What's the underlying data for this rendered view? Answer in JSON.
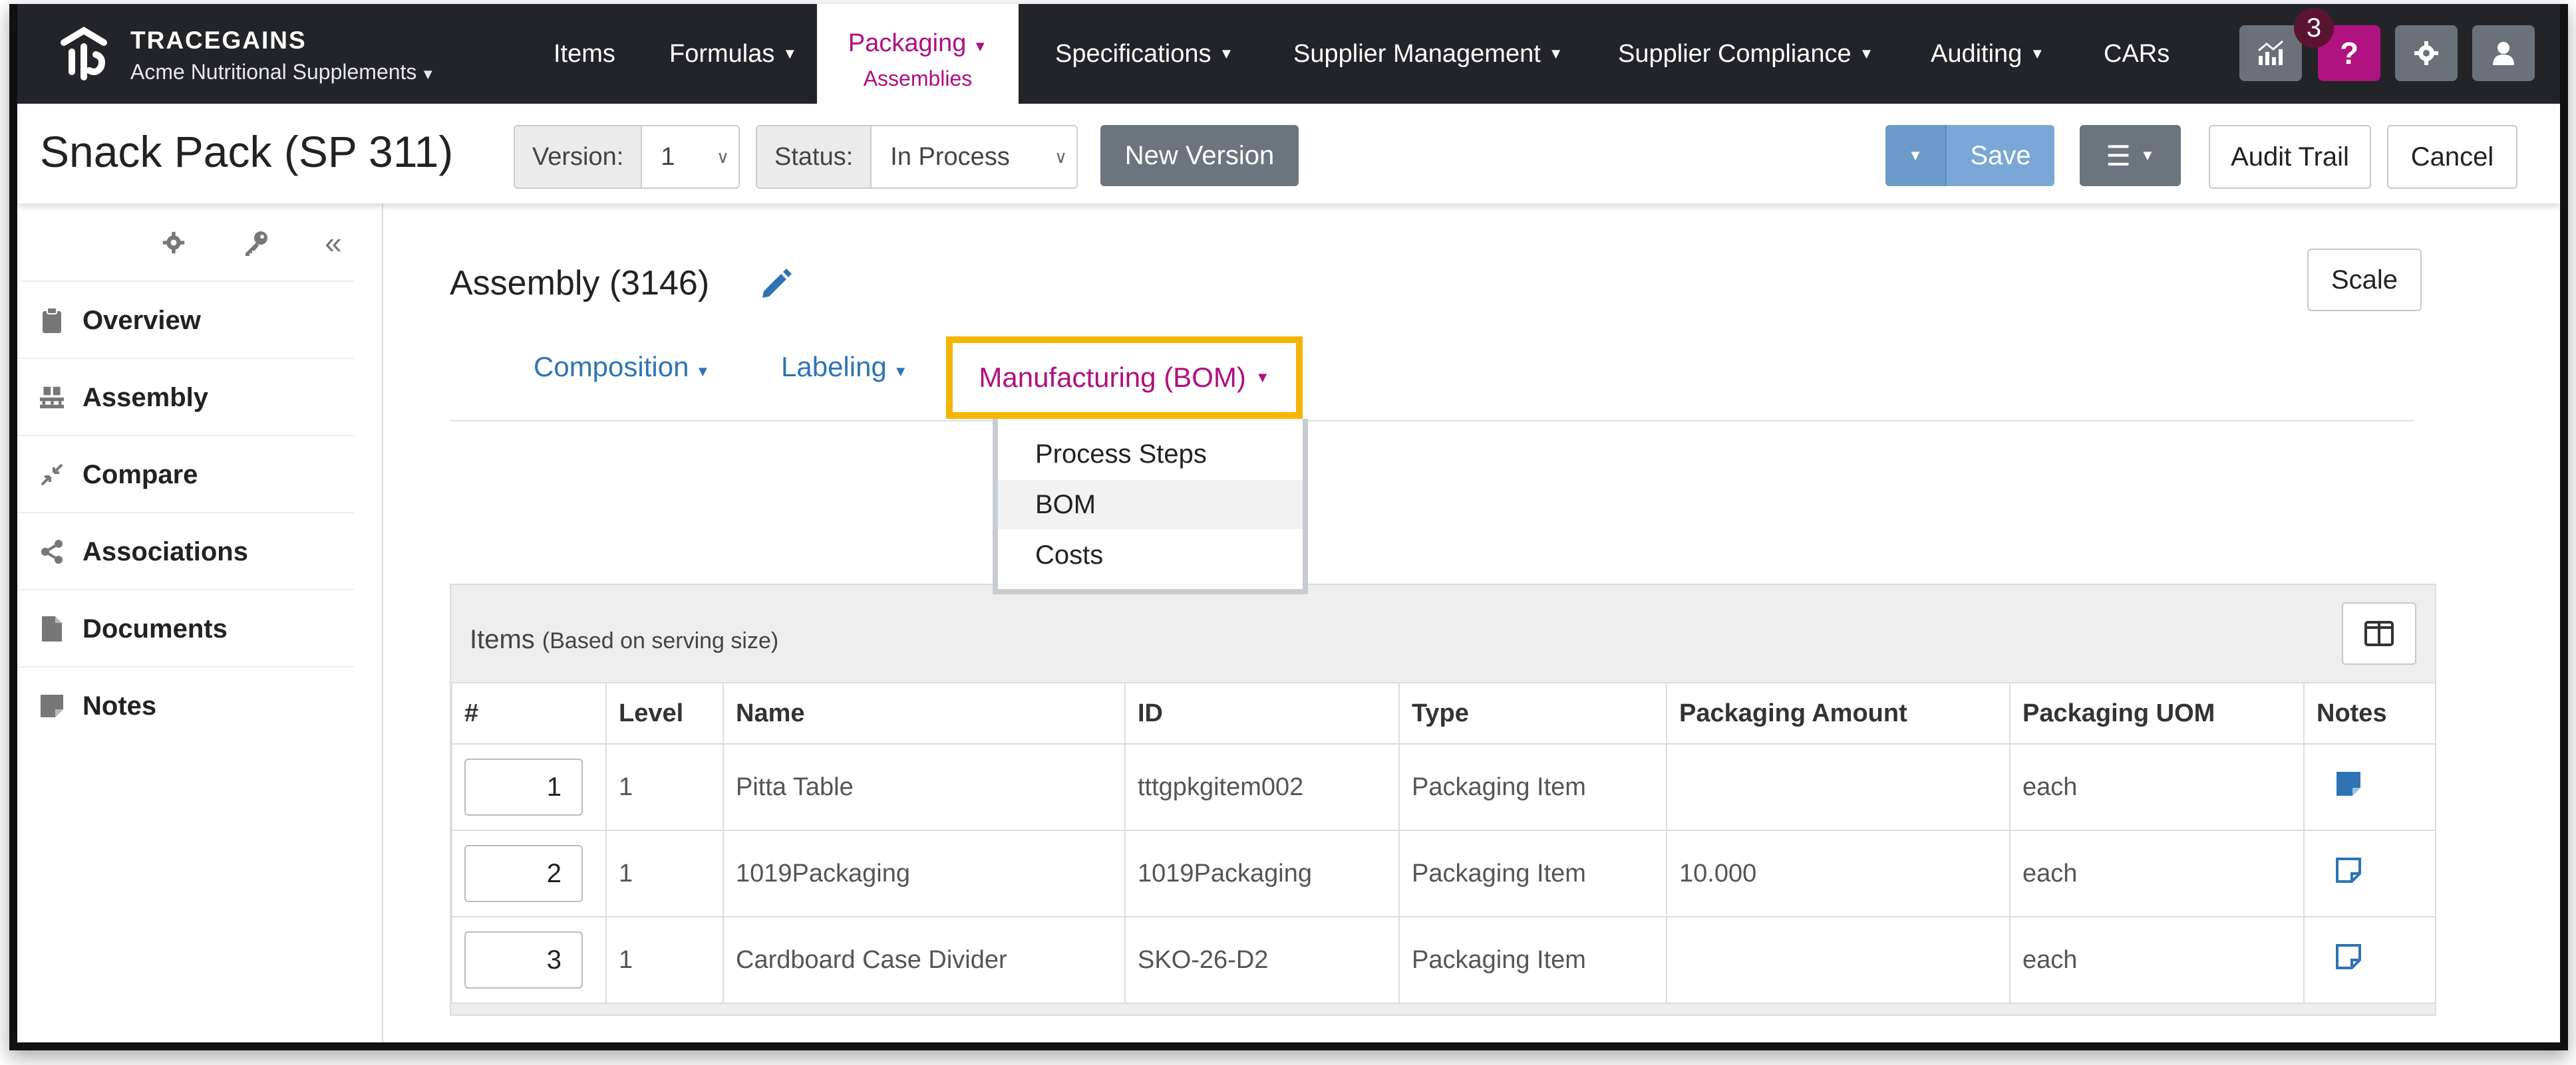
{
  "brand": {
    "name": "TRACEGAINS",
    "company": "Acme Nutritional Supplements"
  },
  "nav": {
    "items": [
      "Items",
      "Formulas",
      "Specifications",
      "Supplier Management",
      "Supplier Compliance",
      "Auditing",
      "CARs"
    ],
    "active": {
      "label": "Packaging",
      "sub": "Assemblies"
    },
    "notification_count": "3",
    "help_label": "?",
    "accent_color": "#b0127f"
  },
  "titlebar": {
    "title": "Snack Pack (SP 311)",
    "version_label": "Version:",
    "version_value": "1",
    "status_label": "Status:",
    "status_value": "In Process",
    "new_version": "New Version",
    "save": "Save",
    "audit_trail": "Audit Trail",
    "cancel": "Cancel"
  },
  "sidebar": {
    "items": [
      {
        "label": "Overview",
        "icon": "clipboard-icon"
      },
      {
        "label": "Assembly",
        "icon": "pallet-icon"
      },
      {
        "label": "Compare",
        "icon": "compress-arrows-icon"
      },
      {
        "label": "Associations",
        "icon": "share-nodes-icon"
      },
      {
        "label": "Documents",
        "icon": "file-icon"
      },
      {
        "label": "Notes",
        "icon": "sticky-note-icon"
      }
    ]
  },
  "main": {
    "assembly_title": "Assembly (3146)",
    "scale": "Scale",
    "tabs": [
      "Composition",
      "Labeling",
      "Manufacturing (BOM)"
    ],
    "dropdown": [
      "Process Steps",
      "BOM",
      "Costs"
    ],
    "items_heading": "Items",
    "items_subheading": "(Based on serving size)",
    "table": {
      "columns": [
        "#",
        "Level",
        "Name",
        "ID",
        "Type",
        "Packaging Amount",
        "Packaging UOM",
        "Notes"
      ],
      "rows": [
        {
          "num": "1",
          "level": "1",
          "name": "Pitta Table",
          "id": "tttgpkgitem002",
          "type": "Packaging Item",
          "amount": "",
          "uom": "each",
          "note": "filled"
        },
        {
          "num": "2",
          "level": "1",
          "name": "1019Packaging",
          "id": "1019Packaging",
          "type": "Packaging Item",
          "amount": "10.000",
          "uom": "each",
          "note": "empty"
        },
        {
          "num": "3",
          "level": "1",
          "name": "Cardboard Case Divider",
          "id": "SKO-26-D2",
          "type": "Packaging Item",
          "amount": "",
          "uom": "each",
          "note": "empty"
        }
      ]
    }
  },
  "colors": {
    "navbar": "#222428",
    "link": "#2e74b5",
    "highlight_border": "#f5b400"
  }
}
